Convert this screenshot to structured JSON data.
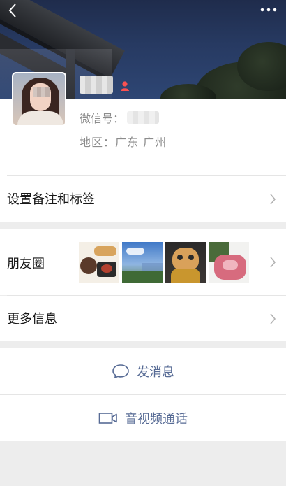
{
  "topbar": {
    "back_icon": "chevron-left-icon",
    "more_icon": "ellipsis-icon"
  },
  "profile": {
    "wechat_id_label": "微信号：",
    "region_label": "地区：",
    "region_value": "广东 广州",
    "gender": "female",
    "gender_icon": "female-icon",
    "gender_color": "#fa5151"
  },
  "rows": {
    "remark": "设置备注和标签",
    "moments": "朋友圈",
    "more_info": "更多信息"
  },
  "actions": {
    "message": "发消息",
    "message_icon": "chat-bubble-icon",
    "call": "音视频通话",
    "call_icon": "video-camera-icon"
  },
  "colors": {
    "link": "#576b95",
    "background": "#ededed",
    "chevron": "#b2b2b2"
  }
}
